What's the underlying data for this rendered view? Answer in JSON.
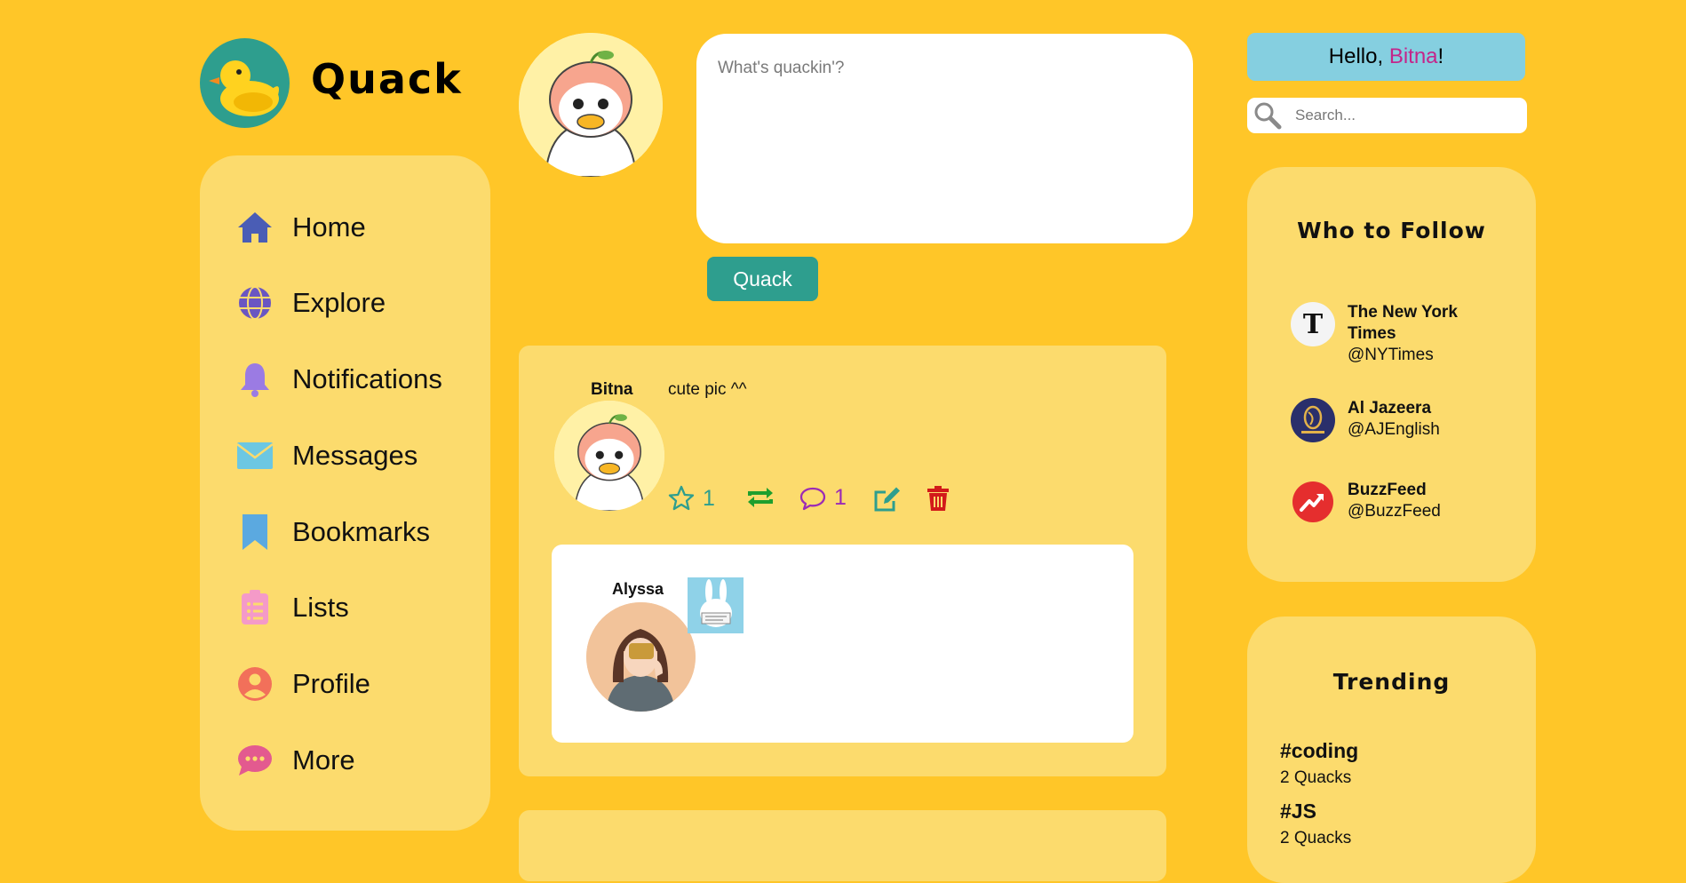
{
  "app": {
    "name": "Quack"
  },
  "nav": {
    "items": [
      {
        "label": "Home",
        "icon": "home-icon",
        "color": "#4A5DB5"
      },
      {
        "label": "Explore",
        "icon": "globe-icon",
        "color": "#6A56C2"
      },
      {
        "label": "Notifications",
        "icon": "bell-icon",
        "color": "#9B7BE3"
      },
      {
        "label": "Messages",
        "icon": "envelope-icon",
        "color": "#6CC7E2"
      },
      {
        "label": "Bookmarks",
        "icon": "bookmark-icon",
        "color": "#5BA9E0"
      },
      {
        "label": "Lists",
        "icon": "clipboard-icon",
        "color": "#F49AC8"
      },
      {
        "label": "Profile",
        "icon": "user-circle-icon",
        "color": "#F2705A"
      },
      {
        "label": "More",
        "icon": "chat-bubble-icon",
        "color": "#E35A8F"
      }
    ]
  },
  "composer": {
    "placeholder": "What's quackin'?",
    "button_label": "Quack"
  },
  "greeting": {
    "prefix": "Hello, ",
    "name": "Bitna",
    "suffix": "!"
  },
  "search": {
    "placeholder": "Search..."
  },
  "feed": {
    "posts": [
      {
        "author": "Bitna",
        "text": "cute pic ^^",
        "stars": "1",
        "comments": "1",
        "reply": {
          "author": "Alyssa"
        }
      }
    ]
  },
  "who_to_follow": {
    "title": "Who to Follow",
    "accounts": [
      {
        "name": "The New York Times",
        "handle": "@NYTimes",
        "icon": "nyt-logo-icon"
      },
      {
        "name": "Al Jazeera",
        "handle": "@AJEnglish",
        "icon": "aljazeera-logo-icon"
      },
      {
        "name": "BuzzFeed",
        "handle": "@BuzzFeed",
        "icon": "buzzfeed-logo-icon"
      }
    ]
  },
  "trending": {
    "title": "Trending",
    "tags": [
      {
        "tag": "#coding",
        "count": "2 Quacks"
      },
      {
        "tag": "#JS",
        "count": "2 Quacks"
      }
    ]
  },
  "colors": {
    "background": "#FFC628",
    "panel": "#FCDB6D",
    "accent_teal": "#2E9E8E",
    "greeting_bg": "#85CFE0",
    "greeting_name": "#C4258A"
  }
}
